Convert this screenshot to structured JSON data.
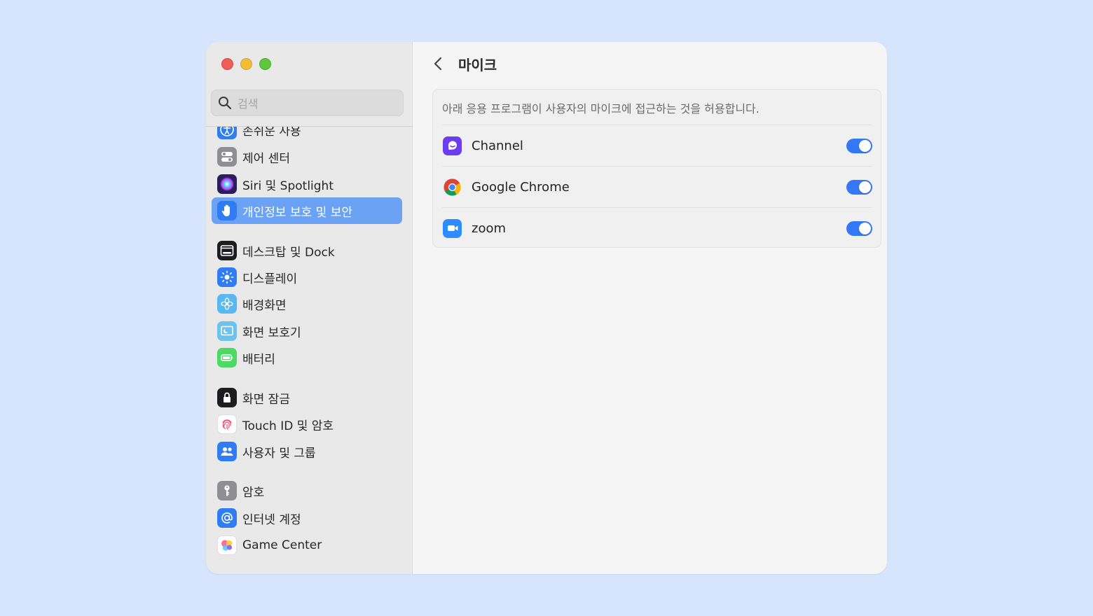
{
  "window": {
    "traffic_lights": [
      "close",
      "minimize",
      "zoom"
    ]
  },
  "search": {
    "placeholder": "검색",
    "icon": "search-icon"
  },
  "sidebar": {
    "items": [
      {
        "label": "손쉬운 사용",
        "icon": "accessibility-icon",
        "color": "#2f7cf5"
      },
      {
        "label": "제어 센터",
        "icon": "control-center-icon",
        "color": "#8e8e93"
      },
      {
        "label": "Siri 및 Spotlight",
        "icon": "siri-icon",
        "color": "#6a3fd3"
      },
      {
        "label": "개인정보 보호 및 보안",
        "icon": "hand-icon",
        "color": "#2f7cf5",
        "active": true
      },
      {
        "label": "데스크탑 및 Dock",
        "icon": "dock-icon",
        "color": "#1c1c1e"
      },
      {
        "label": "디스플레이",
        "icon": "display-icon",
        "color": "#2f7cf5"
      },
      {
        "label": "배경화면",
        "icon": "wallpaper-icon",
        "color": "#5ab8f0"
      },
      {
        "label": "화면 보호기",
        "icon": "screensaver-icon",
        "color": "#6cc3ee"
      },
      {
        "label": "배터리",
        "icon": "battery-icon",
        "color": "#4cd964"
      },
      {
        "label": "화면 잠금",
        "icon": "lock-icon",
        "color": "#1c1c1e"
      },
      {
        "label": "Touch ID 및 암호",
        "icon": "fingerprint-icon",
        "color": "#ffffff"
      },
      {
        "label": "사용자 및 그룹",
        "icon": "users-icon",
        "color": "#2f7cf5"
      },
      {
        "label": "암호",
        "icon": "key-icon",
        "color": "#8e8e93"
      },
      {
        "label": "인터넷 계정",
        "icon": "at-icon",
        "color": "#2f7cf5"
      },
      {
        "label": "Game Center",
        "icon": "game-center-icon",
        "color": "#ffffff"
      }
    ]
  },
  "header": {
    "title": "마이크",
    "back_icon": "chevron-left-icon"
  },
  "permissions": {
    "description": "아래 응용 프로그램이 사용자의 마이크에 접근하는 것을 허용합니다.",
    "apps": [
      {
        "name": "Channel",
        "icon": "channel-icon",
        "enabled": true,
        "color": "#6a3ef0"
      },
      {
        "name": "Google Chrome",
        "icon": "chrome-icon",
        "enabled": true
      },
      {
        "name": "zoom",
        "icon": "zoom-icon",
        "enabled": true,
        "color": "#2d8cff"
      }
    ]
  },
  "colors": {
    "accent": "#3478f6",
    "selection": "#6ba2f4",
    "background": "#d6e4fc"
  }
}
